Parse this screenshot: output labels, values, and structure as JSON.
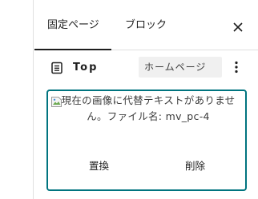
{
  "tabs": [
    {
      "label": "固定ページ"
    },
    {
      "label": "ブロック"
    }
  ],
  "close_icon": "close-icon",
  "document": {
    "icon": "page-icon",
    "title": "Top",
    "badge": "ホームページ",
    "more_icon": "more-vertical-icon"
  },
  "image_card": {
    "broken_image_icon": "broken-image-icon",
    "alt_text": "現在の画像に代替テキストがありません。ファイル名: mv_pc-4",
    "replace_label": "置換",
    "delete_label": "削除"
  },
  "colors": {
    "accent": "#00747f",
    "border": "#e0e0e0",
    "badge_bg": "#f0f0f0"
  }
}
